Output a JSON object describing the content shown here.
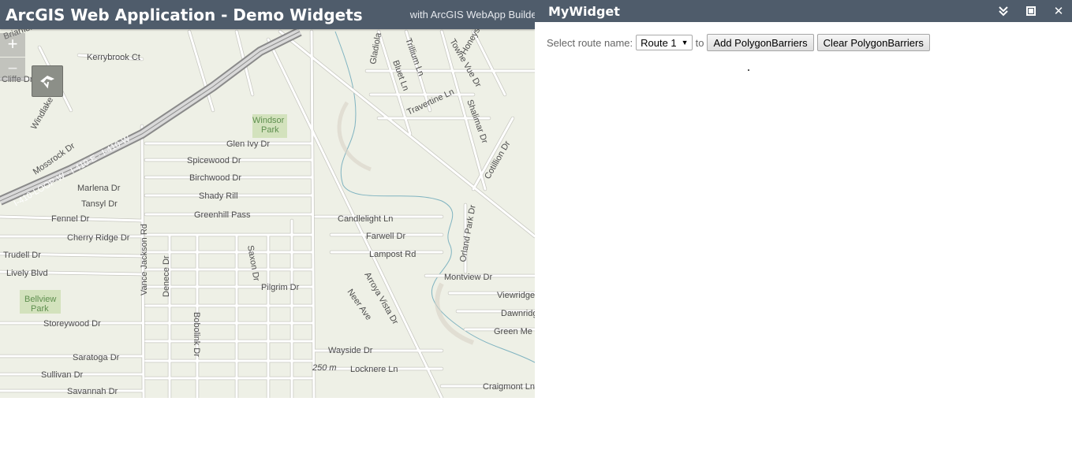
{
  "app": {
    "title": "ArcGIS Web Application - Demo Widgets",
    "subtitle": "with ArcGIS WebApp Builder"
  },
  "map": {
    "zoom_in": "+",
    "zoom_out": "−",
    "colors": {
      "background": "#eef0e6",
      "road": "#ffffff",
      "road_edge": "#c9c9c3",
      "highway": "#8c8c8c",
      "park": "#c9dcb0",
      "creek": "#6fa9b8"
    },
    "streets": [
      "Briarfield Dr",
      "Kerrybrook Ct",
      "Cliffe Dr",
      "Windlake Dr",
      "Mossrock Dr",
      "Glen Ivy Dr",
      "Spicewood Dr",
      "Birchwood Dr",
      "Shady Rill",
      "Greenhill Pass",
      "Marlena Dr",
      "Tansyl Dr",
      "Fennel Dr",
      "Cherry Ridge Dr",
      "Trudell Dr",
      "Lively Blvd",
      "Storeywood Dr",
      "Saratoga Dr",
      "Sullivan Dr",
      "Savannah Dr",
      "Vance Jackson Rd",
      "Denece Dr",
      "Bobolink Dr",
      "Saxon Dr",
      "Pilgrim Dr",
      "Candlelight Ln",
      "Farwell Dr",
      "Lampost Rd",
      "Montview Dr",
      "Viewridge",
      "Dawnridge",
      "Green Me",
      "Wayside Dr",
      "Locknere Ln",
      "Craigmont Ln",
      "Neer Ave",
      "Arroya Vista Dr",
      "Orland Park Dr",
      "Travertine Ln",
      "Shalimar Dr",
      "Cotillion Dr",
      "Gladiola",
      "Trillium Ln",
      "Bluet Ln",
      "Towne Vue Dr",
      "Honeysuckle Ln"
    ],
    "parks": [
      "Windsor",
      "Park",
      "Bellview",
      "Park"
    ],
    "highway_label": "I-410-LOOP-W · I-410-E · I-410-W",
    "scale_label": "250 m"
  },
  "panel": {
    "title": "MyWidget",
    "icons": [
      "collapse-icon",
      "maximize-icon",
      "close-icon"
    ],
    "close_glyph": "✕",
    "select_label": "Select route name:",
    "selected_route": "Route 1",
    "to_label": "to",
    "add_button": "Add PolygonBarriers",
    "clear_button": "Clear PolygonBarriers"
  }
}
